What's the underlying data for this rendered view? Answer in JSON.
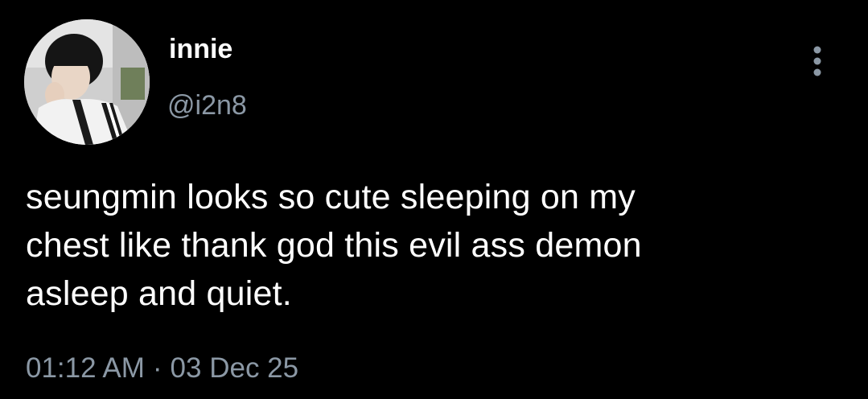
{
  "author": {
    "display_name": "innie",
    "handle": "@i2n8",
    "avatar_icon": "profile-photo"
  },
  "tweet": {
    "text": "seungmin looks so cute sleeping on my\nchest like thank god this evil ass demon\nasleep and quiet.",
    "time": "01:12 AM",
    "separator": "·",
    "date": "03 Dec 25"
  },
  "actions": {
    "more_icon": "more-vertical-icon"
  },
  "colors": {
    "background": "#000000",
    "text_primary": "#ffffff",
    "text_secondary": "#8b98a5"
  }
}
